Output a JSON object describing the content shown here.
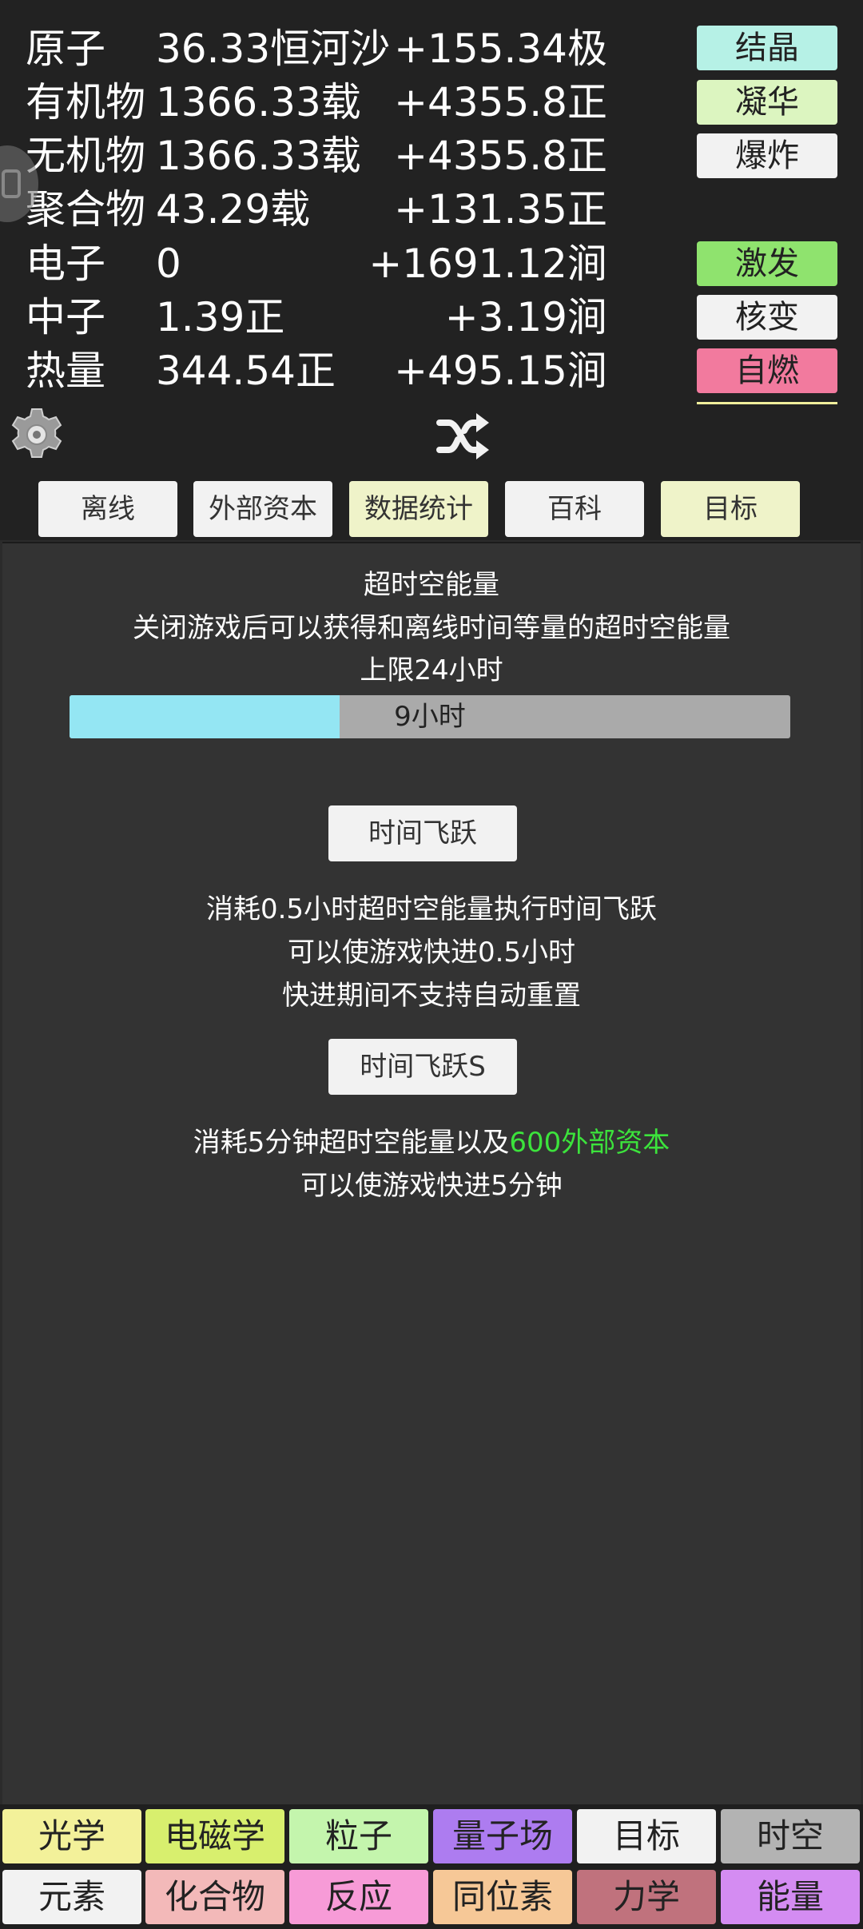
{
  "resources": [
    {
      "name": "原子",
      "amount": "36.33恒河沙",
      "rate": "+155.34极"
    },
    {
      "name": "有机物",
      "amount": "1366.33载",
      "rate": "+4355.8正"
    },
    {
      "name": "无机物",
      "amount": "1366.33载",
      "rate": "+4355.8正"
    },
    {
      "name": "聚合物",
      "amount": "43.29载",
      "rate": "+131.35正"
    },
    {
      "name": "电子",
      "amount": "0",
      "rate": "+1691.12涧"
    },
    {
      "name": "中子",
      "amount": "1.39正",
      "rate": "+3.19涧"
    },
    {
      "name": "热量",
      "amount": "344.54正",
      "rate": "+495.15涧"
    }
  ],
  "actions": [
    {
      "label": "结晶",
      "color": "#b6f1e6"
    },
    {
      "label": "凝华",
      "color": "#dcf5c0"
    },
    {
      "label": "爆炸",
      "color": "#f2f2f2"
    },
    {
      "label": "激发",
      "color": "#8fe36e"
    },
    {
      "label": "核变",
      "color": "#f2f2f2"
    },
    {
      "label": "自燃",
      "color": "#f27a9e"
    }
  ],
  "tabs": [
    {
      "label": "离线",
      "color": "#f2f2f2"
    },
    {
      "label": "外部资本",
      "color": "#f2f2f2"
    },
    {
      "label": "数据统计",
      "color": "#eff3c9"
    },
    {
      "label": "百科",
      "color": "#f2f2f2"
    },
    {
      "label": "目标",
      "color": "#eff3c9"
    }
  ],
  "offline": {
    "title": "超时空能量",
    "desc": "关闭游戏后可以获得和离线时间等量的超时空能量",
    "limit": "上限24小时",
    "progress_text": "9小时",
    "progress_fraction": 0.375,
    "leap_button": "时间飞跃",
    "leap_desc": [
      "消耗0.5小时超时空能量执行时间飞跃",
      "可以使游戏快进0.5小时",
      "快进期间不支持自动重置"
    ],
    "leap_s_button": "时间飞跃S",
    "leap_s_desc_prefix": "消耗5分钟超时空能量以及",
    "leap_s_desc_highlight": "600外部资本",
    "leap_s_desc2": "可以使游戏快进5分钟",
    "highlight_color": "#3ce33c"
  },
  "nav": [
    {
      "label": "光学",
      "color": "#f3f19a"
    },
    {
      "label": "电磁学",
      "color": "#d8ef6e"
    },
    {
      "label": "粒子",
      "color": "#c4f5ad"
    },
    {
      "label": "量子场",
      "color": "#ad7cf0"
    },
    {
      "label": "目标",
      "color": "#f2f2f2"
    },
    {
      "label": "时空",
      "color": "#b3b3b3"
    },
    {
      "label": "元素",
      "color": "#f2f2f2"
    },
    {
      "label": "化合物",
      "color": "#f3b9b9"
    },
    {
      "label": "反应",
      "color": "#f79bd7"
    },
    {
      "label": "同位素",
      "color": "#f6c897"
    },
    {
      "label": "力学",
      "color": "#c0727d"
    },
    {
      "label": "能量",
      "color": "#d48cf2"
    }
  ],
  "icons": {
    "settings": "gear-icon",
    "shuffle": "shuffle-icon",
    "side_handle": "side-handle-icon"
  }
}
